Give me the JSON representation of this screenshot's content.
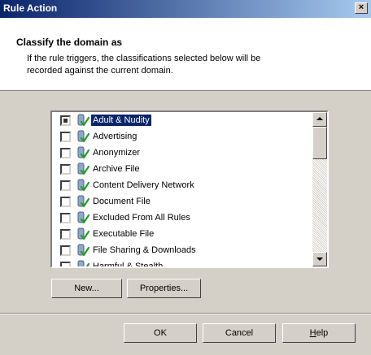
{
  "window": {
    "title": "Rule Action",
    "close": "×"
  },
  "header": {
    "title": "Classify the domain as",
    "description": "If the rule triggers, the classifications selected below will be recorded against the current domain."
  },
  "list": {
    "items": [
      {
        "label": "Adult & Nudity",
        "checked": true,
        "selected": true
      },
      {
        "label": "Advertising",
        "checked": false
      },
      {
        "label": "Anonymizer",
        "checked": false
      },
      {
        "label": "Archive File",
        "checked": false
      },
      {
        "label": "Content Delivery Network",
        "checked": false
      },
      {
        "label": "Document File",
        "checked": false
      },
      {
        "label": "Excluded From All Rules",
        "checked": false
      },
      {
        "label": "Executable File",
        "checked": false
      },
      {
        "label": "File Sharing & Downloads",
        "checked": false
      },
      {
        "label": "Harmful & Stealth",
        "checked": false
      }
    ],
    "icon": "category-icon"
  },
  "buttons": {
    "new": "New...",
    "properties": "Properties...",
    "ok": "OK",
    "cancel": "Cancel",
    "help_u": "H",
    "help_rest": "elp"
  }
}
